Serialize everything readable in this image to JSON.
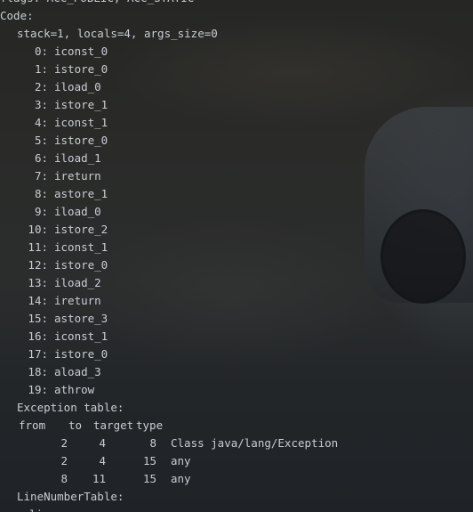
{
  "flags_line": "flags: ACC_PUBLIC, ACC_STATIC",
  "code_label": "Code:",
  "stack_line": "stack=1, locals=4, args_size=0",
  "instructions": [
    {
      "idx": "0:",
      "op": "iconst_0"
    },
    {
      "idx": "1:",
      "op": "istore_0"
    },
    {
      "idx": "2:",
      "op": "iload_0"
    },
    {
      "idx": "3:",
      "op": "istore_1"
    },
    {
      "idx": "4:",
      "op": "iconst_1"
    },
    {
      "idx": "5:",
      "op": "istore_0"
    },
    {
      "idx": "6:",
      "op": "iload_1"
    },
    {
      "idx": "7:",
      "op": "ireturn"
    },
    {
      "idx": "8:",
      "op": "astore_1"
    },
    {
      "idx": "9:",
      "op": "iload_0"
    },
    {
      "idx": "10:",
      "op": "istore_2"
    },
    {
      "idx": "11:",
      "op": "iconst_1"
    },
    {
      "idx": "12:",
      "op": "istore_0"
    },
    {
      "idx": "13:",
      "op": "iload_2"
    },
    {
      "idx": "14:",
      "op": "ireturn"
    },
    {
      "idx": "15:",
      "op": "astore_3"
    },
    {
      "idx": "16:",
      "op": "iconst_1"
    },
    {
      "idx": "17:",
      "op": "istore_0"
    },
    {
      "idx": "18:",
      "op": "aload_3"
    },
    {
      "idx": "19:",
      "op": "athrow"
    }
  ],
  "exception_table": {
    "label": "Exception table:",
    "headers": {
      "from": "from",
      "to": "to",
      "target": "target",
      "type": "type"
    },
    "rows": [
      {
        "from": "2",
        "to": "4",
        "target": "8",
        "type": "Class java/lang/Exception"
      },
      {
        "from": "2",
        "to": "4",
        "target": "15",
        "type": "any"
      },
      {
        "from": "8",
        "to": "11",
        "target": "15",
        "type": "any"
      }
    ]
  },
  "line_number_table_label": "LineNumberTable:",
  "line_number_table_partial": "line"
}
